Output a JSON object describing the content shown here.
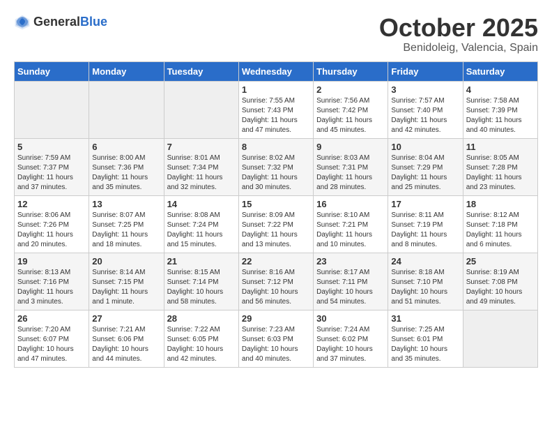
{
  "header": {
    "logo_line1": "General",
    "logo_line2": "Blue",
    "month": "October 2025",
    "location": "Benidoleig, Valencia, Spain"
  },
  "weekdays": [
    "Sunday",
    "Monday",
    "Tuesday",
    "Wednesday",
    "Thursday",
    "Friday",
    "Saturday"
  ],
  "weeks": [
    [
      {
        "day": "",
        "info": ""
      },
      {
        "day": "",
        "info": ""
      },
      {
        "day": "",
        "info": ""
      },
      {
        "day": "1",
        "info": "Sunrise: 7:55 AM\nSunset: 7:43 PM\nDaylight: 11 hours\nand 47 minutes."
      },
      {
        "day": "2",
        "info": "Sunrise: 7:56 AM\nSunset: 7:42 PM\nDaylight: 11 hours\nand 45 minutes."
      },
      {
        "day": "3",
        "info": "Sunrise: 7:57 AM\nSunset: 7:40 PM\nDaylight: 11 hours\nand 42 minutes."
      },
      {
        "day": "4",
        "info": "Sunrise: 7:58 AM\nSunset: 7:39 PM\nDaylight: 11 hours\nand 40 minutes."
      }
    ],
    [
      {
        "day": "5",
        "info": "Sunrise: 7:59 AM\nSunset: 7:37 PM\nDaylight: 11 hours\nand 37 minutes."
      },
      {
        "day": "6",
        "info": "Sunrise: 8:00 AM\nSunset: 7:36 PM\nDaylight: 11 hours\nand 35 minutes."
      },
      {
        "day": "7",
        "info": "Sunrise: 8:01 AM\nSunset: 7:34 PM\nDaylight: 11 hours\nand 32 minutes."
      },
      {
        "day": "8",
        "info": "Sunrise: 8:02 AM\nSunset: 7:32 PM\nDaylight: 11 hours\nand 30 minutes."
      },
      {
        "day": "9",
        "info": "Sunrise: 8:03 AM\nSunset: 7:31 PM\nDaylight: 11 hours\nand 28 minutes."
      },
      {
        "day": "10",
        "info": "Sunrise: 8:04 AM\nSunset: 7:29 PM\nDaylight: 11 hours\nand 25 minutes."
      },
      {
        "day": "11",
        "info": "Sunrise: 8:05 AM\nSunset: 7:28 PM\nDaylight: 11 hours\nand 23 minutes."
      }
    ],
    [
      {
        "day": "12",
        "info": "Sunrise: 8:06 AM\nSunset: 7:26 PM\nDaylight: 11 hours\nand 20 minutes."
      },
      {
        "day": "13",
        "info": "Sunrise: 8:07 AM\nSunset: 7:25 PM\nDaylight: 11 hours\nand 18 minutes."
      },
      {
        "day": "14",
        "info": "Sunrise: 8:08 AM\nSunset: 7:24 PM\nDaylight: 11 hours\nand 15 minutes."
      },
      {
        "day": "15",
        "info": "Sunrise: 8:09 AM\nSunset: 7:22 PM\nDaylight: 11 hours\nand 13 minutes."
      },
      {
        "day": "16",
        "info": "Sunrise: 8:10 AM\nSunset: 7:21 PM\nDaylight: 11 hours\nand 10 minutes."
      },
      {
        "day": "17",
        "info": "Sunrise: 8:11 AM\nSunset: 7:19 PM\nDaylight: 11 hours\nand 8 minutes."
      },
      {
        "day": "18",
        "info": "Sunrise: 8:12 AM\nSunset: 7:18 PM\nDaylight: 11 hours\nand 6 minutes."
      }
    ],
    [
      {
        "day": "19",
        "info": "Sunrise: 8:13 AM\nSunset: 7:16 PM\nDaylight: 11 hours\nand 3 minutes."
      },
      {
        "day": "20",
        "info": "Sunrise: 8:14 AM\nSunset: 7:15 PM\nDaylight: 11 hours\nand 1 minute."
      },
      {
        "day": "21",
        "info": "Sunrise: 8:15 AM\nSunset: 7:14 PM\nDaylight: 10 hours\nand 58 minutes."
      },
      {
        "day": "22",
        "info": "Sunrise: 8:16 AM\nSunset: 7:12 PM\nDaylight: 10 hours\nand 56 minutes."
      },
      {
        "day": "23",
        "info": "Sunrise: 8:17 AM\nSunset: 7:11 PM\nDaylight: 10 hours\nand 54 minutes."
      },
      {
        "day": "24",
        "info": "Sunrise: 8:18 AM\nSunset: 7:10 PM\nDaylight: 10 hours\nand 51 minutes."
      },
      {
        "day": "25",
        "info": "Sunrise: 8:19 AM\nSunset: 7:08 PM\nDaylight: 10 hours\nand 49 minutes."
      }
    ],
    [
      {
        "day": "26",
        "info": "Sunrise: 7:20 AM\nSunset: 6:07 PM\nDaylight: 10 hours\nand 47 minutes."
      },
      {
        "day": "27",
        "info": "Sunrise: 7:21 AM\nSunset: 6:06 PM\nDaylight: 10 hours\nand 44 minutes."
      },
      {
        "day": "28",
        "info": "Sunrise: 7:22 AM\nSunset: 6:05 PM\nDaylight: 10 hours\nand 42 minutes."
      },
      {
        "day": "29",
        "info": "Sunrise: 7:23 AM\nSunset: 6:03 PM\nDaylight: 10 hours\nand 40 minutes."
      },
      {
        "day": "30",
        "info": "Sunrise: 7:24 AM\nSunset: 6:02 PM\nDaylight: 10 hours\nand 37 minutes."
      },
      {
        "day": "31",
        "info": "Sunrise: 7:25 AM\nSunset: 6:01 PM\nDaylight: 10 hours\nand 35 minutes."
      },
      {
        "day": "",
        "info": ""
      }
    ]
  ]
}
